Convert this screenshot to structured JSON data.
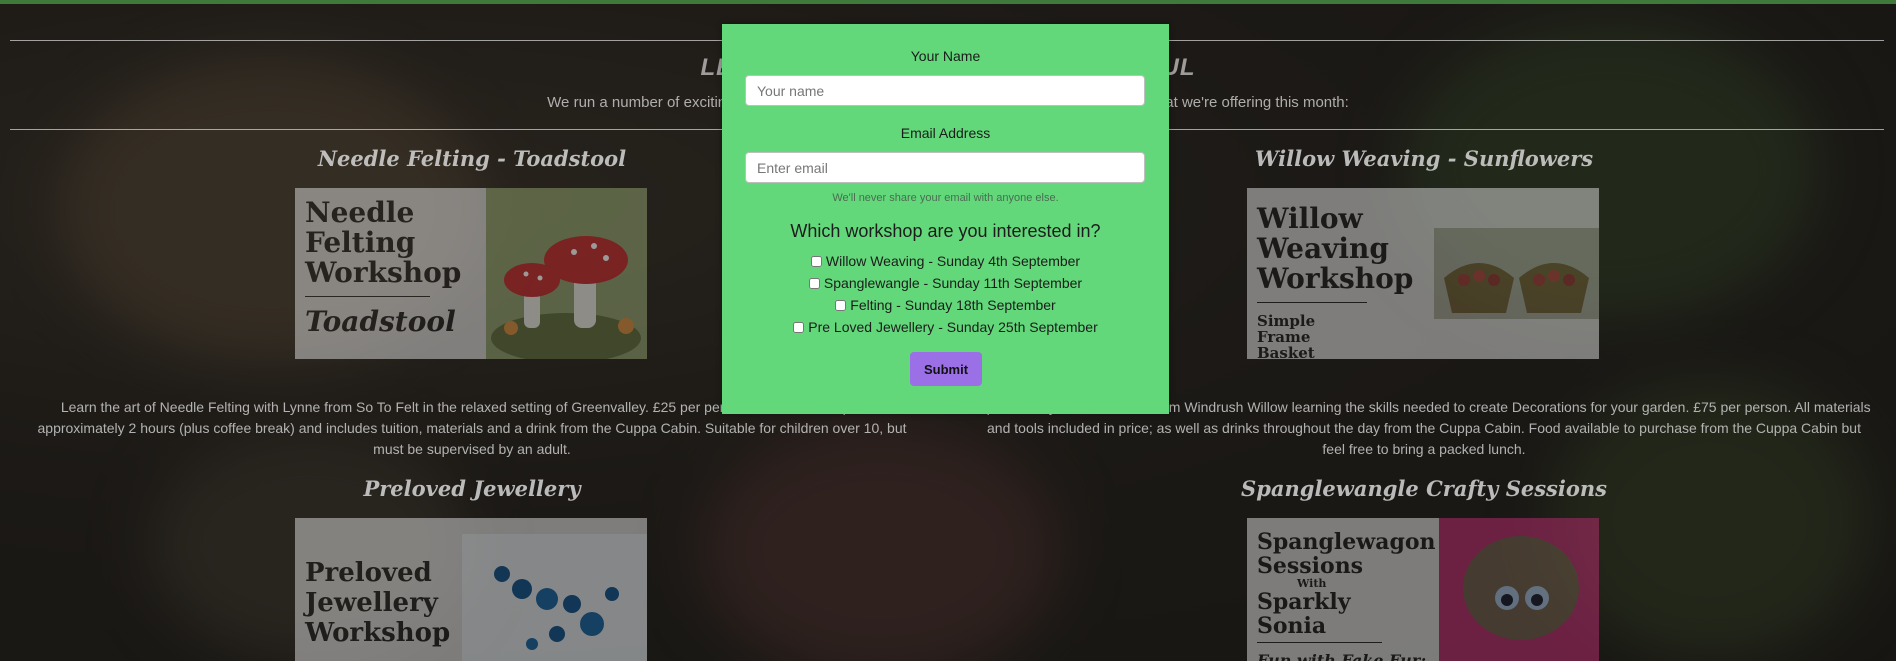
{
  "page": {
    "banner_title": "LEARN SOMETHING NEW & BEAUTIFUL",
    "banner_subtitle": "We run a number of exciting workshops throughout the year at Greenvalley, take a look at what we're offering this month:"
  },
  "workshops": [
    {
      "title": "Needle Felting - Toadstool",
      "poster_lines": [
        "Needle",
        "Felting",
        "Workshop"
      ],
      "poster_sub": "Toadstool",
      "description": "Learn the art of Needle Felting with Lynne from So To Felt in the relaxed setting of Greenvalley. £25 per person. Each workshop lasts approximately 2 hours (plus coffee break) and includes tuition, materials and a drink from the Cuppa Cabin. Suitable for children over 10, but must be supervised by an adult."
    },
    {
      "title": "Willow Weaving - Sunflowers",
      "poster_lines": [
        "Willow",
        "Weaving",
        "Workshop"
      ],
      "poster_sub": "Simple Frame Basket",
      "description": "Spend a day with Katherine from Windrush Willow learning the skills needed to create Decorations for your garden. £75 per person. All materials and tools included in price; as well as drinks throughout the day from the Cuppa Cabin. Food available to purchase from the Cuppa Cabin but feel free to bring a packed lunch."
    },
    {
      "title": "Preloved Jewellery",
      "poster_lines": [
        "Preloved",
        "Jewellery",
        "Workshop"
      ]
    },
    {
      "title": "Spanglewangle Crafty Sessions",
      "poster_lines": [
        "Spanglewagon",
        "Sessions",
        "With",
        "Sparkly",
        "Sonia"
      ],
      "poster_sub": "Fun with Fake Fur:"
    }
  ],
  "modal": {
    "name_label": "Your Name",
    "name_placeholder": "Your name",
    "email_label": "Email Address",
    "email_placeholder": "Enter email",
    "email_help": "We'll never share your email with anyone else.",
    "question": "Which workshop are you interested in?",
    "options": [
      "Willow Weaving - Sunday 4th September",
      "Spanglewangle - Sunday 11th September",
      "Felting - Sunday 18th September",
      "Pre Loved Jewellery - Sunday 25th September"
    ],
    "submit_label": "Submit",
    "background_color": "#62d87a",
    "submit_color": "#9b6fe6"
  },
  "colors": {
    "top_bar": "#3f7a3b"
  }
}
